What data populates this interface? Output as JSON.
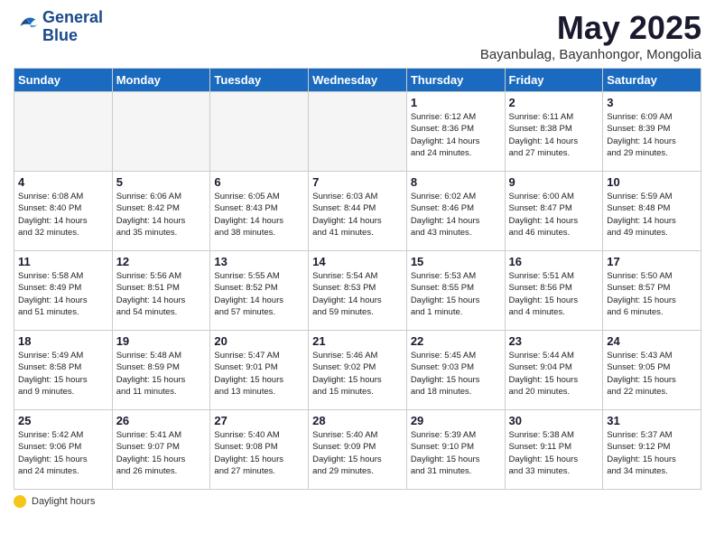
{
  "header": {
    "logo_line1": "General",
    "logo_line2": "Blue",
    "month": "May 2025",
    "location": "Bayanbulag, Bayanhongor, Mongolia"
  },
  "days_of_week": [
    "Sunday",
    "Monday",
    "Tuesday",
    "Wednesday",
    "Thursday",
    "Friday",
    "Saturday"
  ],
  "footer_label": "Daylight hours",
  "weeks": [
    [
      {
        "day": "",
        "info": "",
        "empty": true
      },
      {
        "day": "",
        "info": "",
        "empty": true
      },
      {
        "day": "",
        "info": "",
        "empty": true
      },
      {
        "day": "",
        "info": "",
        "empty": true
      },
      {
        "day": "1",
        "info": "Sunrise: 6:12 AM\nSunset: 8:36 PM\nDaylight: 14 hours\nand 24 minutes."
      },
      {
        "day": "2",
        "info": "Sunrise: 6:11 AM\nSunset: 8:38 PM\nDaylight: 14 hours\nand 27 minutes."
      },
      {
        "day": "3",
        "info": "Sunrise: 6:09 AM\nSunset: 8:39 PM\nDaylight: 14 hours\nand 29 minutes."
      }
    ],
    [
      {
        "day": "4",
        "info": "Sunrise: 6:08 AM\nSunset: 8:40 PM\nDaylight: 14 hours\nand 32 minutes."
      },
      {
        "day": "5",
        "info": "Sunrise: 6:06 AM\nSunset: 8:42 PM\nDaylight: 14 hours\nand 35 minutes."
      },
      {
        "day": "6",
        "info": "Sunrise: 6:05 AM\nSunset: 8:43 PM\nDaylight: 14 hours\nand 38 minutes."
      },
      {
        "day": "7",
        "info": "Sunrise: 6:03 AM\nSunset: 8:44 PM\nDaylight: 14 hours\nand 41 minutes."
      },
      {
        "day": "8",
        "info": "Sunrise: 6:02 AM\nSunset: 8:46 PM\nDaylight: 14 hours\nand 43 minutes."
      },
      {
        "day": "9",
        "info": "Sunrise: 6:00 AM\nSunset: 8:47 PM\nDaylight: 14 hours\nand 46 minutes."
      },
      {
        "day": "10",
        "info": "Sunrise: 5:59 AM\nSunset: 8:48 PM\nDaylight: 14 hours\nand 49 minutes."
      }
    ],
    [
      {
        "day": "11",
        "info": "Sunrise: 5:58 AM\nSunset: 8:49 PM\nDaylight: 14 hours\nand 51 minutes."
      },
      {
        "day": "12",
        "info": "Sunrise: 5:56 AM\nSunset: 8:51 PM\nDaylight: 14 hours\nand 54 minutes."
      },
      {
        "day": "13",
        "info": "Sunrise: 5:55 AM\nSunset: 8:52 PM\nDaylight: 14 hours\nand 57 minutes."
      },
      {
        "day": "14",
        "info": "Sunrise: 5:54 AM\nSunset: 8:53 PM\nDaylight: 14 hours\nand 59 minutes."
      },
      {
        "day": "15",
        "info": "Sunrise: 5:53 AM\nSunset: 8:55 PM\nDaylight: 15 hours\nand 1 minute."
      },
      {
        "day": "16",
        "info": "Sunrise: 5:51 AM\nSunset: 8:56 PM\nDaylight: 15 hours\nand 4 minutes."
      },
      {
        "day": "17",
        "info": "Sunrise: 5:50 AM\nSunset: 8:57 PM\nDaylight: 15 hours\nand 6 minutes."
      }
    ],
    [
      {
        "day": "18",
        "info": "Sunrise: 5:49 AM\nSunset: 8:58 PM\nDaylight: 15 hours\nand 9 minutes."
      },
      {
        "day": "19",
        "info": "Sunrise: 5:48 AM\nSunset: 8:59 PM\nDaylight: 15 hours\nand 11 minutes."
      },
      {
        "day": "20",
        "info": "Sunrise: 5:47 AM\nSunset: 9:01 PM\nDaylight: 15 hours\nand 13 minutes."
      },
      {
        "day": "21",
        "info": "Sunrise: 5:46 AM\nSunset: 9:02 PM\nDaylight: 15 hours\nand 15 minutes."
      },
      {
        "day": "22",
        "info": "Sunrise: 5:45 AM\nSunset: 9:03 PM\nDaylight: 15 hours\nand 18 minutes."
      },
      {
        "day": "23",
        "info": "Sunrise: 5:44 AM\nSunset: 9:04 PM\nDaylight: 15 hours\nand 20 minutes."
      },
      {
        "day": "24",
        "info": "Sunrise: 5:43 AM\nSunset: 9:05 PM\nDaylight: 15 hours\nand 22 minutes."
      }
    ],
    [
      {
        "day": "25",
        "info": "Sunrise: 5:42 AM\nSunset: 9:06 PM\nDaylight: 15 hours\nand 24 minutes."
      },
      {
        "day": "26",
        "info": "Sunrise: 5:41 AM\nSunset: 9:07 PM\nDaylight: 15 hours\nand 26 minutes."
      },
      {
        "day": "27",
        "info": "Sunrise: 5:40 AM\nSunset: 9:08 PM\nDaylight: 15 hours\nand 27 minutes."
      },
      {
        "day": "28",
        "info": "Sunrise: 5:40 AM\nSunset: 9:09 PM\nDaylight: 15 hours\nand 29 minutes."
      },
      {
        "day": "29",
        "info": "Sunrise: 5:39 AM\nSunset: 9:10 PM\nDaylight: 15 hours\nand 31 minutes."
      },
      {
        "day": "30",
        "info": "Sunrise: 5:38 AM\nSunset: 9:11 PM\nDaylight: 15 hours\nand 33 minutes."
      },
      {
        "day": "31",
        "info": "Sunrise: 5:37 AM\nSunset: 9:12 PM\nDaylight: 15 hours\nand 34 minutes."
      }
    ]
  ]
}
